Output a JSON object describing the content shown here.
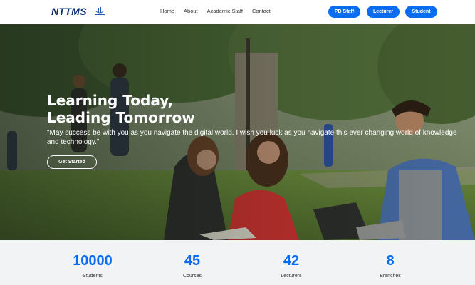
{
  "header": {
    "logo_text": "NTTMS",
    "nav": [
      "Home",
      "About",
      "Academic Staff",
      "Contact"
    ],
    "buttons": {
      "pd_staff": "PD Staff",
      "lecturer": "Lecturer",
      "student": "Student"
    }
  },
  "hero": {
    "title_line1": "Learning Today,",
    "title_line2": "Leading Tomorrow",
    "quote": "\"May success be with you as you navigate the digital world. I wish you luck as you navigate this ever changing world of knowledge and technology.\"",
    "cta_label": "Get Started"
  },
  "stats": [
    {
      "value": "10000",
      "label": "Students"
    },
    {
      "value": "45",
      "label": "Courses"
    },
    {
      "value": "42",
      "label": "Lecturers"
    },
    {
      "value": "8",
      "label": "Branches"
    }
  ],
  "colors": {
    "accent": "#0a6cf1",
    "brand_navy": "#0b2e6e",
    "stats_bg": "#f2f3f5"
  }
}
